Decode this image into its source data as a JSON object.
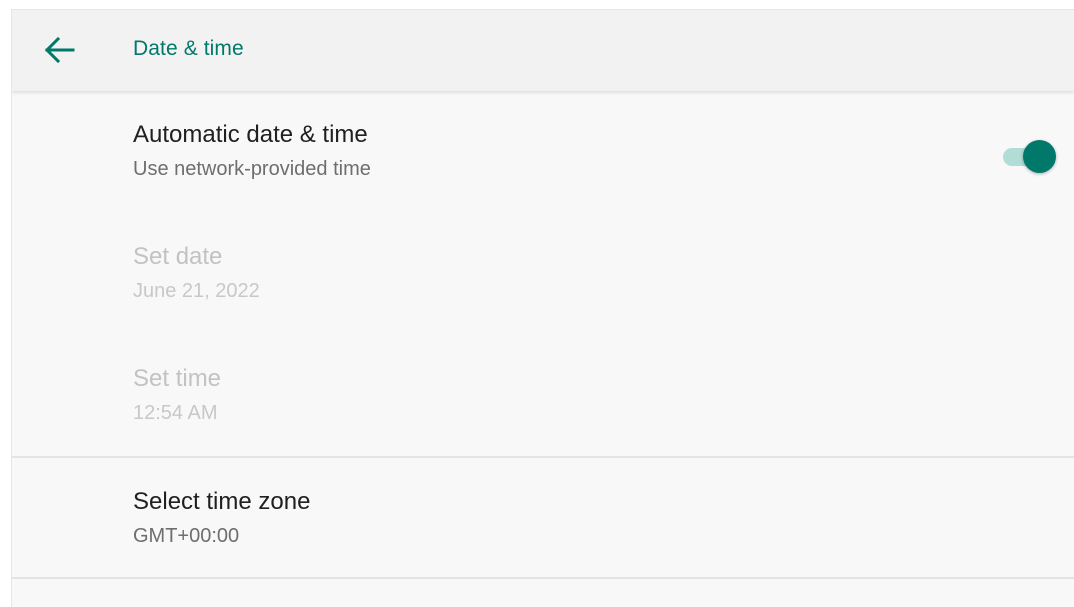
{
  "toolbar": {
    "title": "Date & time",
    "back_icon": "arrow-back-icon"
  },
  "settings": {
    "auto_datetime": {
      "title": "Automatic date & time",
      "summary": "Use network-provided time",
      "enabled": true
    },
    "set_date": {
      "title": "Set date",
      "summary": "June 21, 2022",
      "disabled": true
    },
    "set_time": {
      "title": "Set time",
      "summary": "12:54 AM",
      "disabled": true
    },
    "time_zone": {
      "title": "Select time zone",
      "summary": "GMT+00:00"
    }
  },
  "colors": {
    "accent": "#00796b",
    "switch_thumb": "#00796b",
    "switch_track": "#b2dcd6"
  }
}
